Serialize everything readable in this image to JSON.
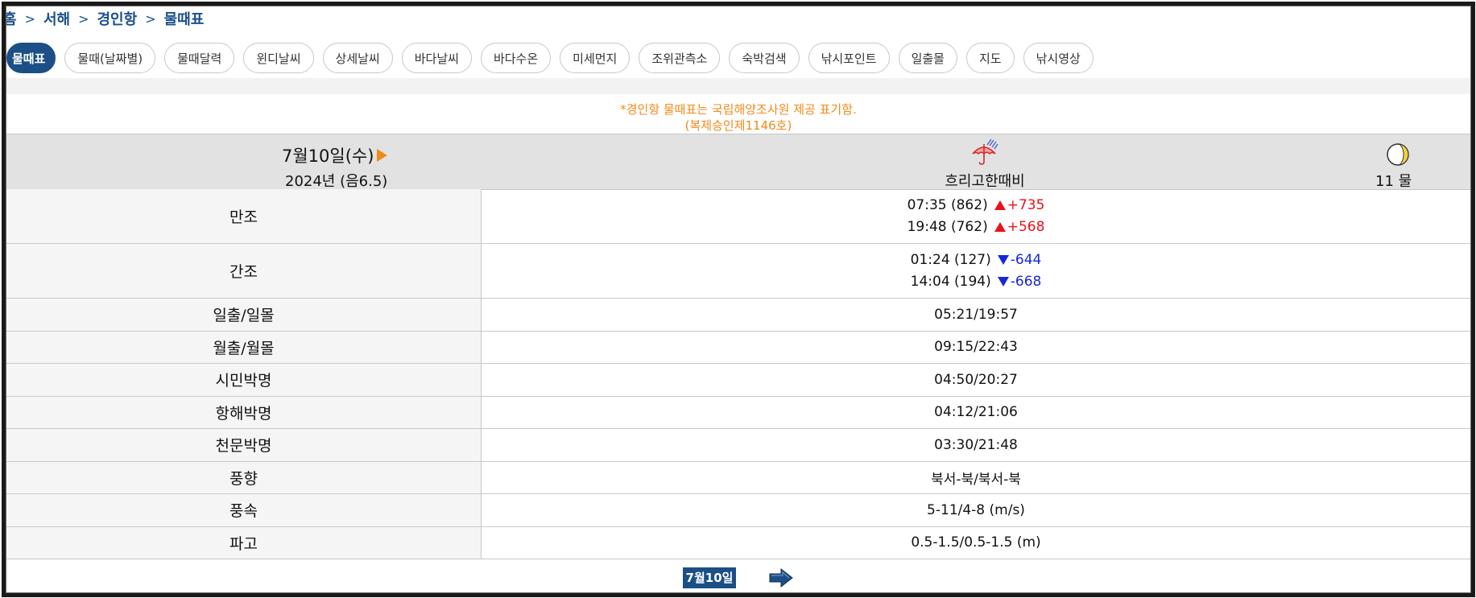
{
  "breadcrumb": {
    "items": [
      "홈",
      "서해",
      "경인항",
      "물때표"
    ],
    "separator": ">"
  },
  "tabs": [
    {
      "label": "물때표",
      "active": true
    },
    {
      "label": "물때(날짜별)",
      "active": false
    },
    {
      "label": "물때달력",
      "active": false
    },
    {
      "label": "윈디날씨",
      "active": false
    },
    {
      "label": "상세날씨",
      "active": false
    },
    {
      "label": "바다날씨",
      "active": false
    },
    {
      "label": "바다수온",
      "active": false
    },
    {
      "label": "미세먼지",
      "active": false
    },
    {
      "label": "조위관측소",
      "active": false
    },
    {
      "label": "숙박검색",
      "active": false
    },
    {
      "label": "낚시포인트",
      "active": false
    },
    {
      "label": "일출몰",
      "active": false
    },
    {
      "label": "지도",
      "active": false
    },
    {
      "label": "낚시영상",
      "active": false
    }
  ],
  "notice": {
    "line1": "*경인항 물때표는 국립해양조사원 제공 표기함.",
    "line2": "(복제승인제1146호)"
  },
  "header": {
    "date": "7월10일(수)",
    "date_sub": "2024년 (음6.5)",
    "weather": "흐리고한때비",
    "weather_icon": "umbrella-rain-icon",
    "moon_icon": "moon-phase-icon",
    "tide": "11 물"
  },
  "rows": {
    "high_tide": {
      "label": "만조",
      "entries": [
        {
          "time": "07:35 (862)",
          "diff": "+735"
        },
        {
          "time": "19:48 (762)",
          "diff": "+568"
        }
      ]
    },
    "low_tide": {
      "label": "간조",
      "entries": [
        {
          "time": "01:24 (127)",
          "diff": "-644"
        },
        {
          "time": "14:04 (194)",
          "diff": "-668"
        }
      ]
    },
    "sunrise": {
      "label": "일출/일몰",
      "value": "05:21/19:57"
    },
    "moonrise": {
      "label": "월출/월몰",
      "value": "09:15/22:43"
    },
    "civil": {
      "label": "시민박명",
      "value": "04:50/20:27"
    },
    "nautical": {
      "label": "항해박명",
      "value": "04:12/21:06"
    },
    "astro": {
      "label": "천문박명",
      "value": "03:30/21:48"
    },
    "wind_dir": {
      "label": "풍향",
      "value": "북서-북/북서-북"
    },
    "wind_speed": {
      "label": "풍속",
      "value": "5-11/4-8 (m/s)"
    },
    "wave": {
      "label": "파고",
      "value": "0.5-1.5/0.5-1.5 (m)"
    }
  },
  "bottom_nav": {
    "date_label": "7월10일",
    "next_icon": "arrow-right-icon"
  },
  "colors": {
    "brand": "#1b4f86",
    "notice": "#f28a1a",
    "rise": "#e8121b",
    "fall": "#1628d6"
  }
}
